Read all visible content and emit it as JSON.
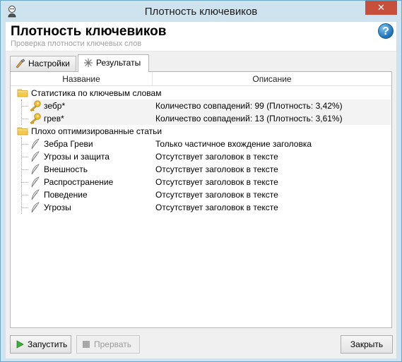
{
  "window": {
    "title": "Плотность ключевиков"
  },
  "header": {
    "title": "Плотность ключевиков",
    "subtitle": "Проверка плотности ключевых слов"
  },
  "tabs": [
    {
      "label": "Настройки",
      "icon": "settings-icon",
      "active": false
    },
    {
      "label": "Результаты",
      "icon": "results-icon",
      "active": true
    }
  ],
  "table": {
    "columns": [
      "Название",
      "Описание"
    ],
    "groups": [
      {
        "name": "Статистика по ключевым словам",
        "items": [
          {
            "name": "зебр*",
            "description": "Количество совпадений: 99 (Плотность: 3,42%)",
            "icon": "key-icon"
          },
          {
            "name": "грев*",
            "description": "Количество совпадений: 13 (Плотность: 3,61%)",
            "icon": "key-icon"
          }
        ]
      },
      {
        "name": "Плохо оптимизированные статьи",
        "items": [
          {
            "name": "Зебра Греви",
            "description": "Только частичное вхождение заголовка",
            "icon": "feather-icon"
          },
          {
            "name": "Угрозы и защита",
            "description": "Отсутствует заголовок в тексте",
            "icon": "feather-icon"
          },
          {
            "name": "Внешность",
            "description": "Отсутствует заголовок в тексте",
            "icon": "feather-icon"
          },
          {
            "name": "Распространение",
            "description": "Отсутствует заголовок в тексте",
            "icon": "feather-icon"
          },
          {
            "name": "Поведение",
            "description": "Отсутствует заголовок в тексте",
            "icon": "feather-icon"
          },
          {
            "name": "Угрозы",
            "description": "Отсутствует заголовок в тексте",
            "icon": "feather-icon"
          }
        ]
      }
    ]
  },
  "buttons": {
    "run": "Запустить",
    "stop": "Прервать",
    "close": "Закрыть"
  },
  "colors": {
    "frame": "#cfe3ee",
    "close_button": "#c7503d",
    "folder": "#f3c94e"
  }
}
